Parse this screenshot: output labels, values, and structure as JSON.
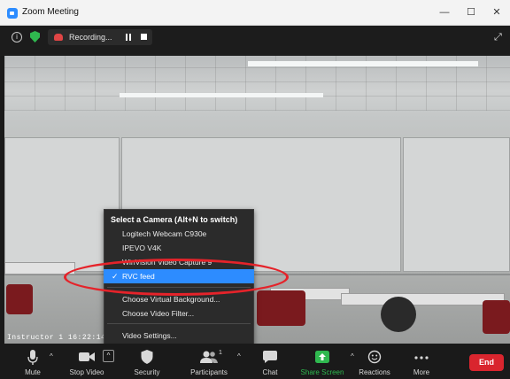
{
  "window": {
    "title": "Zoom Meeting",
    "minimize": "—",
    "maximize": "☐",
    "close": "✕"
  },
  "topbar": {
    "info_glyph": "i",
    "recording_label": "Recording...",
    "expand_glyph": "⤢"
  },
  "video": {
    "timestamp": "Instructor 1 16:22:14.31"
  },
  "camera_menu": {
    "title": "Select a Camera (Alt+N to switch)",
    "cameras": [
      {
        "label": "Logitech Webcam C930e",
        "selected": false
      },
      {
        "label": "IPEVO V4K",
        "selected": false
      },
      {
        "label": "WinVision Video Capture 9",
        "selected": false
      },
      {
        "label": "RVC feed",
        "selected": true
      }
    ],
    "check_glyph": "✓",
    "options": [
      "Choose Virtual Background...",
      "Choose Video Filter..."
    ],
    "settings": "Video Settings..."
  },
  "toolbar": {
    "mute": "Mute",
    "stop_video": "Stop Video",
    "security": "Security",
    "participants": "Participants",
    "participant_count": "1",
    "chat": "Chat",
    "share_screen": "Share Screen",
    "reactions": "Reactions",
    "more": "More",
    "end": "End",
    "caret": "^"
  },
  "colors": {
    "accent": "#2d8cff",
    "share_green": "#2fb84f",
    "end_red": "#d9252e",
    "highlight_oval": "#e5232a"
  }
}
